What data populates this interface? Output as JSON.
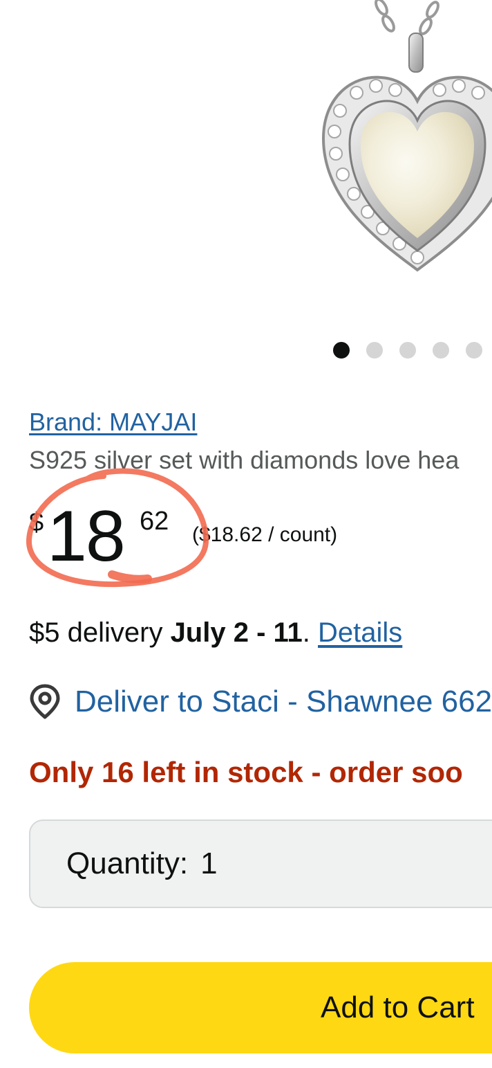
{
  "product_image": {
    "icon": "heart-pendant-necklace-image"
  },
  "carousel": {
    "total_dots": 5,
    "active_index": 0
  },
  "product": {
    "brand_link": "Brand: MAYJAI",
    "title": "S925 silver set with diamonds love hea"
  },
  "price": {
    "currency_symbol": "$",
    "whole": "18",
    "fraction": "62",
    "unit_price": "($18.62 / count)"
  },
  "delivery": {
    "prefix": "$5 delivery ",
    "dates": "July 2 - 11",
    "separator": ". ",
    "details_link": "Details"
  },
  "deliver_to": {
    "label": "Deliver to Staci - Shawnee 662",
    "icon": "location-pin-icon"
  },
  "stock": {
    "message": "Only 16 left in stock - order soo"
  },
  "quantity": {
    "label": "Quantity:",
    "value": "1"
  },
  "buttons": {
    "add_to_cart": "Add to Cart"
  },
  "colors": {
    "link": "#2162a1",
    "stock_red": "#b12704",
    "button_yellow": "#ffd814",
    "annotation": "#f26a50"
  }
}
